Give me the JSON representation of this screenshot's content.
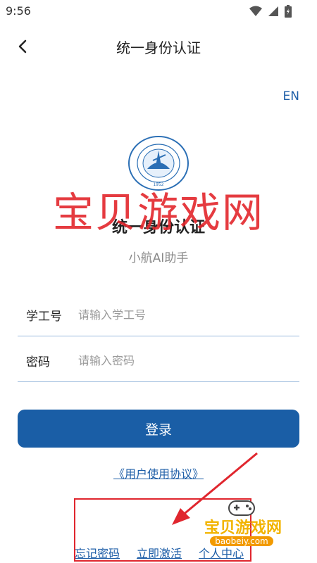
{
  "status_bar": {
    "time": "9:56",
    "icons": [
      "wifi-icon",
      "signal-icon",
      "battery-icon"
    ]
  },
  "header": {
    "title": "统一身份认证",
    "back_icon": "chevron-left-icon"
  },
  "language_toggle": "EN",
  "logo": {
    "icon": "university-seal-icon",
    "year": "1952"
  },
  "portal": {
    "title": "统一身份认证",
    "subtitle": "小航AI助手"
  },
  "form": {
    "id_field": {
      "label": "学工号",
      "placeholder": "请输入学工号",
      "value": ""
    },
    "password_field": {
      "label": "密码",
      "placeholder": "请输入密码",
      "value": ""
    },
    "login_label": "登录"
  },
  "agreement_link": "《用户使用协议》",
  "bottom_links": {
    "forgot": "忘记密码",
    "activate": "立即激活",
    "personal": "个人中心"
  },
  "watermark": {
    "text": "宝贝游戏网",
    "corner_text": "宝贝游戏网",
    "corner_sub": "baobeiy.com"
  },
  "colors": {
    "primary": "#1a5ea6",
    "link": "#1f5fa8",
    "annotation": "#e0262e",
    "underline": "#9ab9dd"
  }
}
